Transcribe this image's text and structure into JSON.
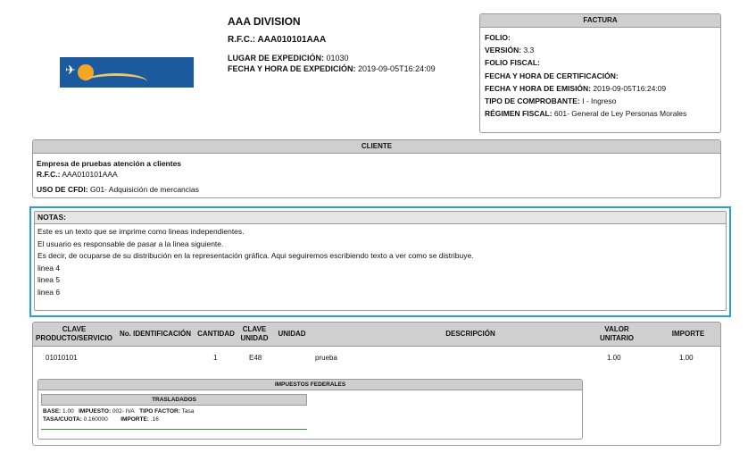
{
  "emisor": {
    "nombre": "AAA DIVISION",
    "rfc": "R.F.C.: AAA010101AAA",
    "lugar_label": "LUGAR  DE EXPEDICIÓN:",
    "lugar_value": " 01030",
    "fecha_label": "FECHA Y HORA DE EXPEDICIÓN:",
    "fecha_value": " 2019-09-05T16:24:09"
  },
  "factura": {
    "title": "FACTURA",
    "rows": [
      {
        "label": "FOLIO:",
        "value": ""
      },
      {
        "label": "VERSIÓN:",
        "value": " 3.3"
      },
      {
        "label": "FOLIO FISCAL:",
        "value": ""
      },
      {
        "label": "FECHA Y HORA DE CERTIFICACIÓN:",
        "value": ""
      },
      {
        "label": "FECHA Y HORA DE EMISIÓN:",
        "value": " 2019-09-05T16:24:09"
      },
      {
        "label": "TIPO DE COMPROBANTE:",
        "value": " I - Ingreso"
      },
      {
        "label": "RÉGIMEN FISCAL:",
        "value": " 601- General de Ley Personas Morales"
      }
    ]
  },
  "cliente": {
    "title": "CLIENTE",
    "nombre": "Empresa de pruebas atención a clientes",
    "rfc_label": "R.F.C.:",
    "rfc_value": " AAA010101AAA",
    "uso_label": "USO DE CFDI:",
    "uso_value": " G01- Adquisición de mercancias"
  },
  "notas": {
    "title": "NOTAS:",
    "lines": [
      "Este es un texto que se imprime como lineas independientes.",
      "El usuario es responsable de pasar a la linea siguiente.",
      "Es decir, de ocuparse de su distribución en la representación gráfica. Aqui seguiremos escribiendo texto a ver como se distribuye.",
      "linea 4",
      "linea 5",
      "linea 6"
    ]
  },
  "conceptos": {
    "headers": {
      "clave1": "CLAVE",
      "clave2": "PRODUCTO/SERVICIO",
      "noid": "No. IDENTIFICACIÓN",
      "cantidad": "CANTIDAD",
      "cu1": "CLAVE",
      "cu2": "UNIDAD",
      "unidad": "UNIDAD",
      "descripcion": "DESCRIPCIÓN",
      "vu1": "VALOR",
      "vu2": "UNITARIO",
      "importe": "IMPORTE"
    },
    "row": {
      "clave": "01010101",
      "cantidad": "1",
      "clave_unidad": "E48",
      "descripcion": "prueba",
      "valor_unitario": "1.00",
      "importe": "1.00"
    }
  },
  "impuestos": {
    "title": "IMPUESTOS FEDERALES",
    "trasladados_title": "TRASLADADOS",
    "base_label": "BASE:",
    "base_value": " 1.00",
    "impuesto_label": "IMPUESTO:",
    "impuesto_value": " 002- IVA",
    "tipo_label": "TIPO FACTOR:",
    "tipo_value": " Tasa",
    "tasa_label": "TASA/CUOTA:",
    "tasa_value": " 0.160000",
    "importe_label": "IMPORTE:",
    "importe_value": " .16"
  }
}
